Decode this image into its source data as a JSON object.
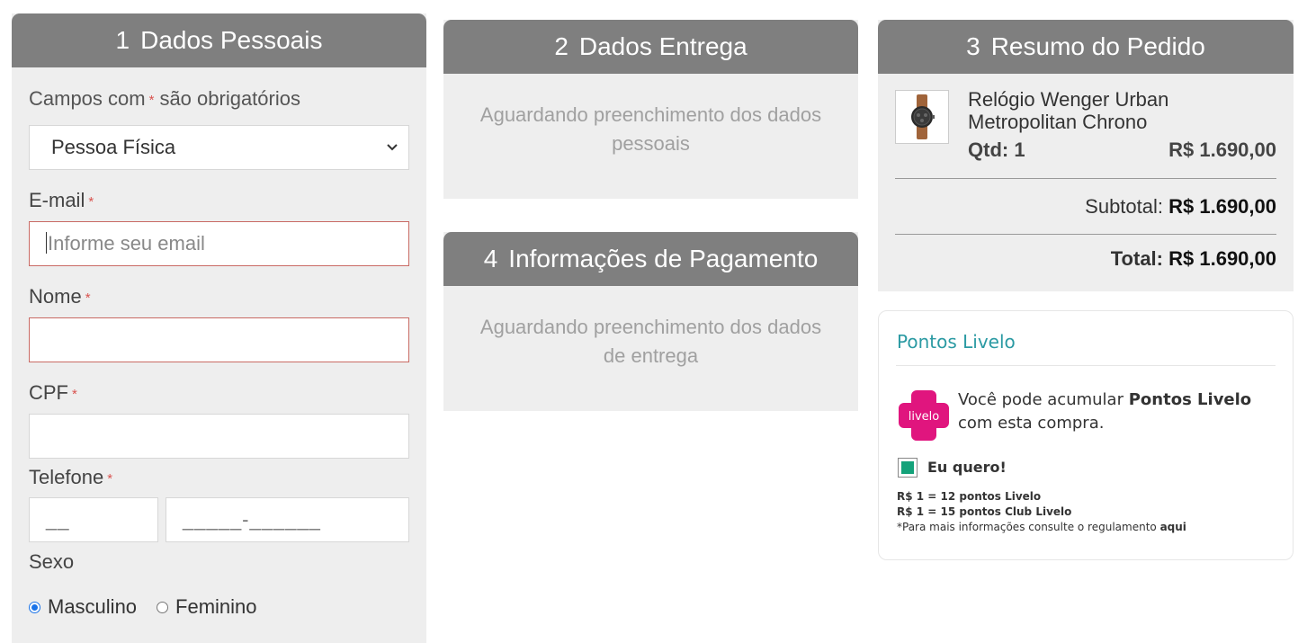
{
  "personal": {
    "step": "1",
    "title": "Dados Pessoais",
    "required_note_prefix": "Campos com",
    "required_star": "*",
    "required_note_suffix": "são obrigatórios",
    "person_type": "Pessoa Física",
    "email_label": "E-mail",
    "email_placeholder": "Informe seu email",
    "name_label": "Nome",
    "cpf_label": "CPF",
    "phone_label": "Telefone",
    "phone_ddd_mask": "__",
    "phone_number_mask": "_____-______",
    "sex_label": "Sexo",
    "sex_options": [
      "Masculino",
      "Feminino"
    ],
    "sex_selected": "Masculino"
  },
  "delivery": {
    "step": "2",
    "title": "Dados Entrega",
    "waiting": "Aguardando preenchimento dos dados pessoais"
  },
  "payment": {
    "step": "4",
    "title": "Informações de Pagamento",
    "waiting": "Aguardando preenchimento dos dados de entrega"
  },
  "summary": {
    "step": "3",
    "title": "Resumo do Pedido",
    "product_name": "Relógio Wenger Urban Metropolitan Chrono",
    "qty": "Qtd: 1",
    "price": "R$ 1.690,00",
    "subtotal_label": "Subtotal:",
    "subtotal_value": "R$ 1.690,00",
    "total_label": "Total:",
    "total_value": "R$ 1.690,00"
  },
  "livelo": {
    "title": "Pontos Livelo",
    "logo_text": "livelo",
    "msg_prefix": "Você pode acumular",
    "msg_bold": "Pontos Livelo",
    "msg_suffix": "com esta compra.",
    "checkbox_label": "Eu quero!",
    "checked": true,
    "rate1": "R$ 1 = 12 pontos Livelo",
    "rate2": "R$ 1 = 15 pontos Club Livelo",
    "footnote": "*Para mais informações consulte o regulamento",
    "footnote_link": "aqui",
    "brand_color": "#e0157e",
    "title_color": "#2b9aa3"
  },
  "colors": {
    "header_bg": "#7f7f7f",
    "panel_bg": "#eeeeee",
    "required": "#d9534f",
    "error_border": "#c96a64"
  }
}
